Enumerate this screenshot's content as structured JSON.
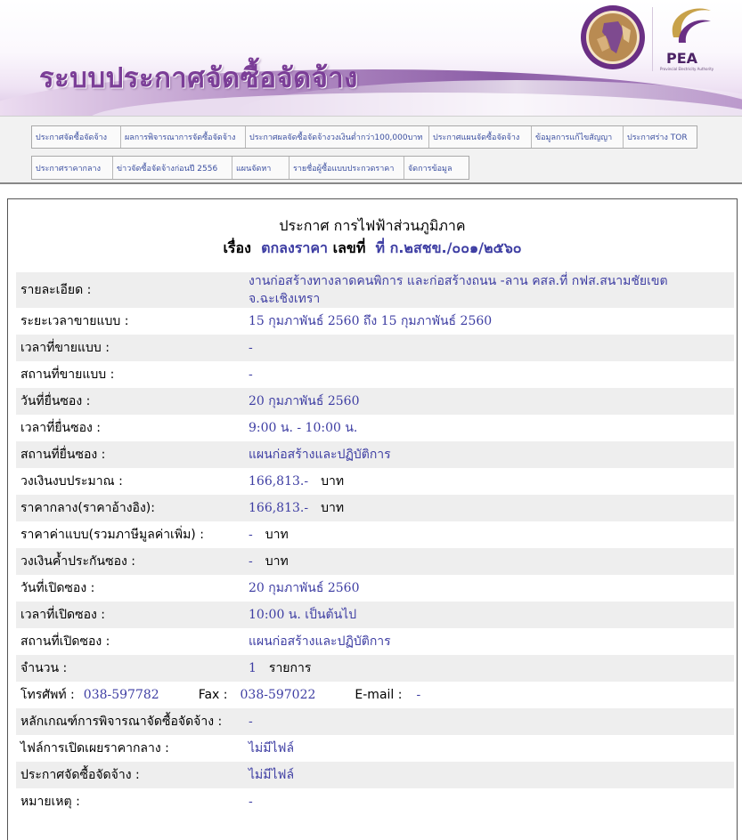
{
  "header": {
    "site_title": "ระบบประกาศจัดซื้อจัดจ้าง",
    "pea_logo_text": "PEA",
    "pea_logo_subtext": "Provincial Electricity Authority"
  },
  "nav": {
    "row1": [
      "ประกาศจัดซื้อจัดจ้าง",
      "ผลการพิจารณาการจัดซื้อจัดจ้าง",
      "ประกาศผลจัดซื้อจัดจ้างวงเงินต่ำกว่า100,000บาท",
      "ประกาศแผนจัดซื้อจัดจ้าง",
      "ข้อมูลการแก้ไขสัญญา",
      "ประกาศร่าง TOR"
    ],
    "row2": [
      "ประกาศราคากลาง",
      "ข่าวจัดซื้อจัดจ้างก่อนปี 2556",
      "แผนจัดหา",
      "รายชื่อผู้ซื้อแบบประกวดราคา",
      "จัดการข้อมูล"
    ]
  },
  "announcement": {
    "title": "ประกาศ การไฟฟ้าส่วนภูมิภาค",
    "subject_label": "เรื่อง",
    "subject": "ตกลงราคา",
    "number_label": "เลขที่",
    "number": "ที่ ก.๒สชข./๐๐๑/๒๕๖๐"
  },
  "details": {
    "description": {
      "label": "รายละเอียด :",
      "value": "งานก่อสร้างทางลาดคนพิการ และก่อสร้างถนน -ลาน คสล.ที่ กฟส.สนามชัยเขต จ.ฉะเชิงเทรา"
    },
    "doc_sale_period": {
      "label": "ระยะเวลาขายแบบ :",
      "value": "15 กุมภาพันธ์ 2560 ถึง 15 กุมภาพันธ์ 2560"
    },
    "doc_sale_time": {
      "label": "เวลาที่ขายแบบ :",
      "value": "-"
    },
    "doc_sale_place": {
      "label": "สถานที่ขายแบบ :",
      "value": "-"
    },
    "submit_date": {
      "label": "วันที่ยื่นซอง :",
      "value": "20 กุมภาพันธ์ 2560"
    },
    "submit_time": {
      "label": "เวลาที่ยื่นซอง :",
      "value": "9:00 น. - 10:00 น."
    },
    "submit_place": {
      "label": "สถานที่ยื่นซอง :",
      "value": "แผนก่อสร้างและปฏิบัติการ"
    },
    "budget": {
      "label": "วงเงินงบประมาณ :",
      "value": "166,813.-",
      "unit": "บาท"
    },
    "median_price": {
      "label": "ราคากลาง(ราคาอ้างอิง):",
      "value": "166,813.-",
      "unit": "บาท"
    },
    "doc_fee": {
      "label": "ราคาค่าแบบ(รวมภาษีมูลค่าเพิ่ม) :",
      "value": "-",
      "unit": "บาท"
    },
    "bid_bond": {
      "label": "วงเงินค้ำประกันซอง :",
      "value": "-",
      "unit": "บาท"
    },
    "open_date": {
      "label": "วันที่เปิดซอง :",
      "value": "20 กุมภาพันธ์ 2560"
    },
    "open_time": {
      "label": "เวลาที่เปิดซอง :",
      "value": "10:00 น. เป็นต้นไป"
    },
    "open_place": {
      "label": "สถานที่เปิดซอง :",
      "value": "แผนก่อสร้างและปฏิบัติการ"
    },
    "quantity": {
      "label": "จำนวน :",
      "value": "1",
      "unit": "รายการ"
    },
    "contact": {
      "phone_label": "โทรศัพท์ :",
      "phone": "038-597782",
      "fax_label": "Fax :",
      "fax": "038-597022",
      "email_label": "E-mail :",
      "email": "-"
    },
    "criteria": {
      "label": "หลักเกณฑ์การพิจารณาจัดซื้อจัดจ้าง :",
      "value": "-"
    },
    "median_file": {
      "label": "ไฟล์การเปิดเผยราคากลาง :",
      "value": "ไม่มีไฟล์"
    },
    "announce_file": {
      "label": "ประกาศจัดซื้อจัดจ้าง :",
      "value": "ไม่มีไฟล์"
    },
    "remark": {
      "label": "หมายเหตุ :",
      "value": "-"
    }
  }
}
